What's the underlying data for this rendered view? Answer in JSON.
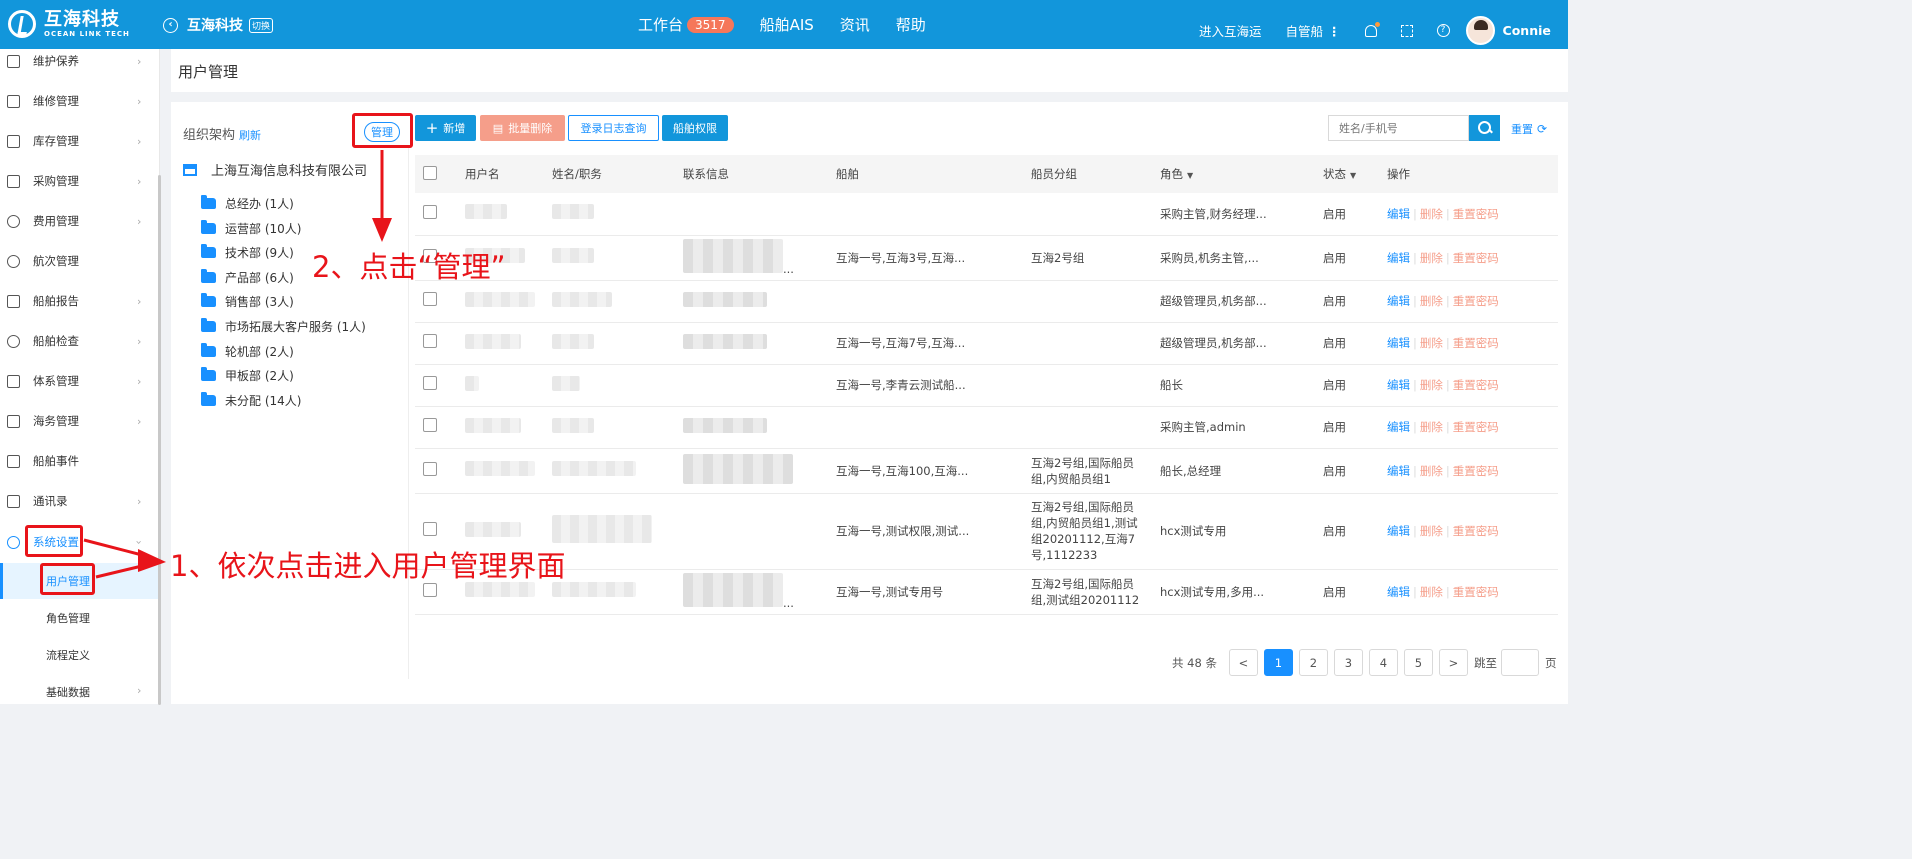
{
  "brand": {
    "name_cn": "互海科技",
    "name_en": "OCEAN LINK TECH"
  },
  "company_switch": {
    "name": "互海科技",
    "tag": "切换"
  },
  "topnav": {
    "workbench": "工作台",
    "workbench_count": "3517",
    "ship_ais": "船舶AIS",
    "news": "资讯",
    "help": "帮助"
  },
  "topright": {
    "enter": "进入互海运",
    "own_ship": "自管船",
    "dots": "⋮",
    "user": "Connie"
  },
  "sidebar": {
    "items": [
      {
        "label": "维护保养"
      },
      {
        "label": "维修管理"
      },
      {
        "label": "库存管理"
      },
      {
        "label": "采购管理"
      },
      {
        "label": "费用管理"
      },
      {
        "label": "航次管理"
      },
      {
        "label": "船舶报告"
      },
      {
        "label": "船舶检查"
      },
      {
        "label": "体系管理"
      },
      {
        "label": "海务管理"
      },
      {
        "label": "船舶事件"
      },
      {
        "label": "通讯录"
      },
      {
        "label": "系统设置"
      }
    ],
    "sub_items": [
      {
        "label": "用户管理"
      },
      {
        "label": "角色管理"
      },
      {
        "label": "流程定义"
      },
      {
        "label": "基础数据"
      }
    ]
  },
  "page_title": "用户管理",
  "org": {
    "title": "组织架构",
    "refresh": "刷新",
    "manage": "管理",
    "root": "上海互海信息科技有限公司",
    "departments": [
      {
        "label": "总经办 (1人)"
      },
      {
        "label": "运营部 (10人)"
      },
      {
        "label": "技术部 (9人)"
      },
      {
        "label": "产品部 (6人)"
      },
      {
        "label": "销售部 (3人)"
      },
      {
        "label": "市场拓展大客户服务 (1人)"
      },
      {
        "label": "轮机部 (2人)"
      },
      {
        "label": "甲板部 (2人)"
      },
      {
        "label": "未分配 (14人)"
      }
    ]
  },
  "toolbar": {
    "add": "新增",
    "batch_delete": "批量删除",
    "login_log": "登录日志查询",
    "ship_perm": "船舶权限",
    "search_placeholder": "姓名/手机号",
    "reset": "重置"
  },
  "table": {
    "headers": {
      "username": "用户名",
      "name_title": "姓名/职务",
      "contact": "联系信息",
      "ship": "船舶",
      "crew_group": "船员分组",
      "role": "角色",
      "status": "状态",
      "ops": "操作"
    },
    "ops": {
      "edit": "编辑",
      "delete": "删除",
      "reset_pwd": "重置密码"
    },
    "rows": [
      {
        "contact_tail": "",
        "ship": "",
        "crew_group": "",
        "role": "采购主管,财务经理...",
        "status": "启用"
      },
      {
        "contact_tail": "...",
        "ship": "互海一号,互海3号,互海...",
        "crew_group": "互海2号组",
        "role": "采购员,机务主管,...",
        "status": "启用"
      },
      {
        "contact_tail": "",
        "ship": "",
        "crew_group": "",
        "role": "超级管理员,机务部...",
        "status": "启用"
      },
      {
        "contact_tail": "",
        "ship": "互海一号,互海7号,互海...",
        "crew_group": "",
        "role": "超级管理员,机务部...",
        "status": "启用"
      },
      {
        "contact_tail": "",
        "ship": "互海一号,李青云测试船...",
        "crew_group": "",
        "role": "船长",
        "status": "启用"
      },
      {
        "contact_tail": "",
        "ship": "",
        "crew_group": "",
        "role": "采购主管,admin",
        "status": "启用"
      },
      {
        "contact_tail": "",
        "ship": "互海一号,互海100,互海...",
        "crew_group": "互海2号组,国际船员组,内贸船员组1",
        "role": "船长,总经理",
        "status": "启用"
      },
      {
        "contact_tail": "",
        "ship": "互海一号,测试权限,测试...",
        "crew_group": "互海2号组,国际船员组,内贸船员组1,测试组20201112,互海7号,1112233",
        "role": "hcx测试专用",
        "status": "启用"
      },
      {
        "contact_tail": "...",
        "ship": "互海一号,测试专用号",
        "crew_group": "互海2号组,国际船员组,测试组20201112",
        "role": "hcx测试专用,多用...",
        "status": "启用"
      }
    ]
  },
  "pagination": {
    "total": "共 48 条",
    "prev": "<",
    "pages": [
      "1",
      "2",
      "3",
      "4",
      "5"
    ],
    "next": ">",
    "jump_label": "跳至",
    "page_unit": "页"
  },
  "annotations": {
    "step1": "1、依次点击进入用户管理界面",
    "step2": "2、点击“管理”"
  }
}
